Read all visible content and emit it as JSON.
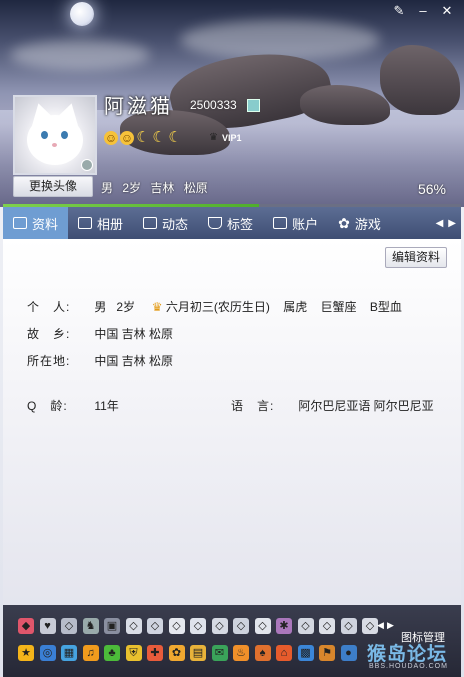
{
  "window": {
    "controls": [
      {
        "icon": "skin-icon",
        "glyph": "✎"
      },
      {
        "icon": "minimize-icon",
        "glyph": "–"
      },
      {
        "icon": "close-icon",
        "glyph": "✕"
      }
    ]
  },
  "profile": {
    "nickname": "阿滋猫",
    "qq_number": "2500333",
    "change_avatar_label": "更换头像",
    "gender": "男",
    "age": "2岁",
    "location": "吉林 松原",
    "completion": "56%",
    "completion_fraction": 0.56,
    "vip_label": "VIP1"
  },
  "tabs": [
    {
      "label": "资料",
      "icon": "profile-card-icon",
      "active": true
    },
    {
      "label": "相册",
      "icon": "album-icon",
      "active": false
    },
    {
      "label": "动态",
      "icon": "feed-icon",
      "active": false
    },
    {
      "label": "标签",
      "icon": "tag-icon",
      "active": false
    },
    {
      "label": "账户",
      "icon": "wallet-icon",
      "active": false
    },
    {
      "label": "游戏",
      "icon": "game-icon",
      "active": false
    }
  ],
  "details": {
    "edit_label": "编辑资料",
    "personal_label": "个　人:",
    "personal": {
      "gender": "男",
      "age": "2岁",
      "birthday": "六月初三(农历生日)",
      "zodiac": "属虎",
      "constellation": "巨蟹座",
      "blood": "B型血"
    },
    "hometown_label": "故　乡:",
    "hometown": "中国 吉林 松原",
    "residence_label": "所在地:",
    "residence": "中国 吉林 松原",
    "qage_label": "Q　龄:",
    "qage": "11年",
    "language_label": "语　言:",
    "language": "阿尔巴尼亚语  阿尔巴尼亚"
  },
  "toolbar": {
    "manage_label": "图标管理",
    "watermark": "猴岛论坛",
    "watermark_sub": "BBS.HOUDAO.COM",
    "row1_icons": [
      "gem-icon",
      "heart-icon",
      "diamond-icon",
      "pet-icon",
      "computer-icon",
      "diamond-icon",
      "diamond-icon",
      "diamond-icon",
      "diamond-icon",
      "diamond-icon",
      "diamond-icon",
      "diamond-icon",
      "gear-icon",
      "diamond-icon",
      "diamond-icon",
      "diamond-icon",
      "diamond-icon"
    ],
    "row2_icons": [
      "star-icon",
      "qzone-icon",
      "app-icon",
      "music-icon",
      "clover-icon",
      "shield-icon",
      "guard-icon",
      "pet2-icon",
      "wallet-icon",
      "mail-icon",
      "cake-icon",
      "game-icon",
      "house-icon",
      "photo-icon",
      "sport-icon",
      "qq-icon"
    ]
  },
  "colors": {
    "tab_bar": "#4a5a80",
    "tab_active": "#6f9dd2",
    "progress": "#5bbf34",
    "toolbar": "#2f3242"
  }
}
